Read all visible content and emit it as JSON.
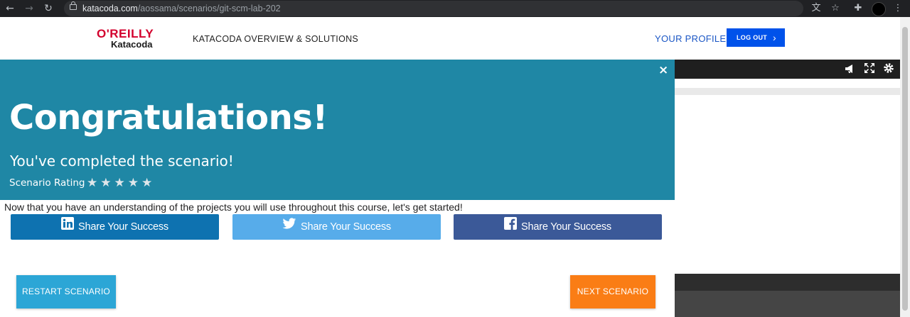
{
  "browser": {
    "url_host": "katacoda.com",
    "url_path": "/aossama/scenarios/git-scm-lab-202",
    "icons": [
      "back-icon",
      "forward-icon",
      "reload-icon",
      "lock-icon",
      "translate-icon",
      "star-icon",
      "extensions-icon",
      "profile-avatar",
      "menu-icon"
    ]
  },
  "header": {
    "logo_top": "O'REILLY",
    "logo_bottom": "Katacoda",
    "overview_link": "KATACODA OVERVIEW & SOLUTIONS",
    "profile_link": "YOUR PROFILE",
    "logout_label": "LOG OUT",
    "logout_color": "#0052ea",
    "logo_color": "#d3002d"
  },
  "modal": {
    "header_color": "#1f87a5",
    "close_label": "×",
    "title": "Congratulations!",
    "subtitle": "You've completed the scenario!",
    "rating_label": "Scenario Rating",
    "rating_max": 5,
    "message": "Now that you have an understanding of the projects you will use throughout this course, let's get started!",
    "share": {
      "linkedin": "Share Your Success",
      "twitter": "Share Your Success",
      "facebook": "Share Your Success"
    },
    "restart_label": "RESTART SCENARIO",
    "next_label": "NEXT SCENARIO"
  },
  "terminal_panel": {
    "icons": [
      "megaphone-icon",
      "fullscreen-icon",
      "settings-icon"
    ]
  }
}
